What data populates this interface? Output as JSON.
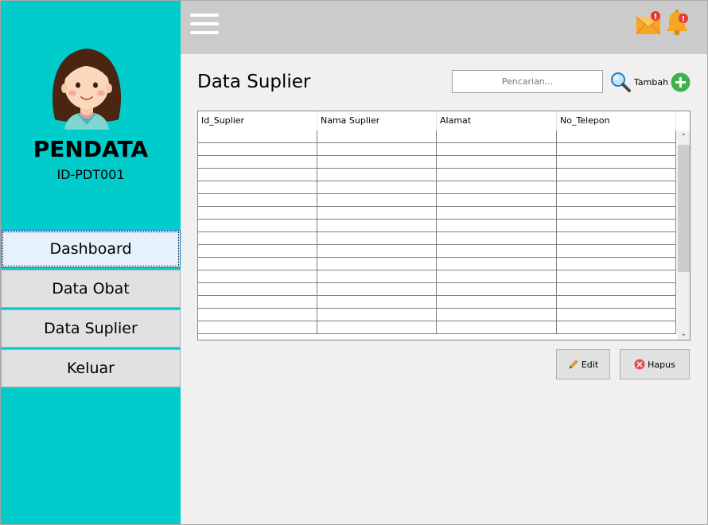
{
  "sidebar": {
    "profile_name": "PENDATA",
    "profile_id": "ID-PDT001",
    "items": [
      {
        "label": "Dashboard"
      },
      {
        "label": "Data Obat"
      },
      {
        "label": "Data Suplier"
      },
      {
        "label": "Keluar"
      }
    ]
  },
  "topbar": {
    "mail_badge": "!",
    "bell_badge": "!"
  },
  "main": {
    "title": "Data Suplier",
    "search_placeholder": "Pencarian...",
    "add_label": "Tambah",
    "table": {
      "columns": [
        "Id_Suplier",
        "Nama Suplier",
        "Alamat",
        "No_Telepon"
      ],
      "rows": []
    },
    "edit_label": "Edit",
    "delete_label": "Hapus"
  },
  "colors": {
    "sidebar": "#00cccc",
    "topbar": "#cbcbcb",
    "add_accent": "#3cb44b",
    "delete_accent": "#e0514f"
  }
}
